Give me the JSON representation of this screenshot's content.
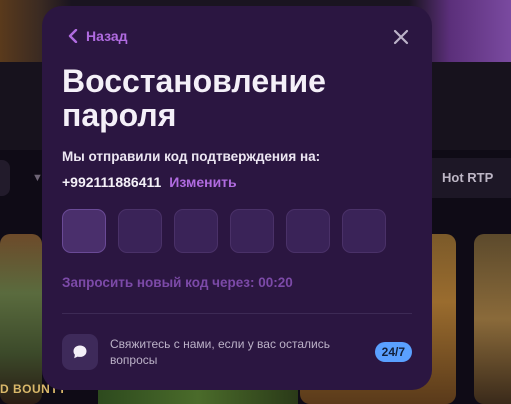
{
  "background": {
    "tab_hot": "Hot RTP",
    "game_left_title": "D BOUNTY"
  },
  "modal": {
    "back_label": "Назад",
    "title": "Восстановление пароля",
    "sent_text": "Мы отправили код подтверждения на:",
    "phone": "+992111886411",
    "change_label": "Изменить",
    "code_cells": 6,
    "resend_text": "Запросить новый код через: 00:20",
    "support_text": "Свяжитесь с нами, если у вас остались вопросы",
    "support_badge": "24/7"
  },
  "colors": {
    "modal_bg": "#2b1641",
    "accent": "#b06be0",
    "badge": "#5aa0ff"
  }
}
